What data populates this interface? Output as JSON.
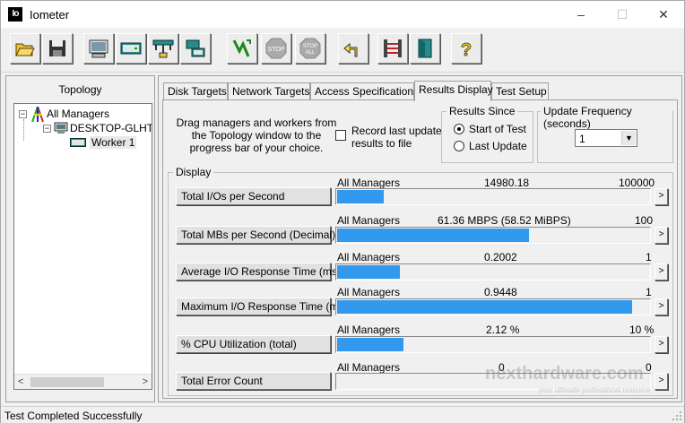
{
  "window": {
    "title": "Iometer",
    "app_icon": "Io",
    "minimize": "–",
    "maximize": "☐",
    "close": "✕"
  },
  "toolbar": {
    "buttons": [
      {
        "name": "open-config-icon"
      },
      {
        "name": "save-config-icon"
      },
      {
        "name": "show-results-icon"
      },
      {
        "name": "new-disk-worker-icon"
      },
      {
        "name": "new-network-worker-icon"
      },
      {
        "name": "duplicate-worker-icon"
      },
      {
        "name": "start-tests-icon"
      },
      {
        "name": "stop-icon"
      },
      {
        "name": "stop-all-icon"
      },
      {
        "name": "reset-workers-icon"
      },
      {
        "name": "exit-icon"
      },
      {
        "name": "about-icon"
      }
    ],
    "stop_label": "STOP",
    "stop_all_label_1": "STOP",
    "stop_all_label_2": "ALL",
    "help_label": "?"
  },
  "topology": {
    "title": "Topology",
    "all_managers": "All Managers",
    "manager": "DESKTOP-GLHTN",
    "worker": "Worker 1",
    "collapse_symbol": "−",
    "scroll_left": "<",
    "scroll_right": ">"
  },
  "tabs": [
    {
      "label": "Disk Targets"
    },
    {
      "label": "Network Targets"
    },
    {
      "label": "Access Specifications"
    },
    {
      "label": "Results Display"
    },
    {
      "label": "Test Setup"
    }
  ],
  "results": {
    "drag_text": "Drag managers and workers from the Topology window to the progress bar of your choice.",
    "record_label": "Record last update results to file",
    "record_checked": false,
    "results_since_title": "Results Since",
    "start_of_test": "Start of Test",
    "last_update": "Last Update",
    "selected_since": "Start of Test",
    "update_freq_title": "Update Frequency (seconds)",
    "update_freq_value": "1",
    "display_title": "Display",
    "metrics": [
      {
        "label": "Total I/Os per Second",
        "source": "All Managers",
        "value": "14980.18",
        "max": "100000",
        "fraction": 0.1498
      },
      {
        "label": "Total MBs per Second (Decimal)",
        "source": "All Managers",
        "value": "61.36 MBPS (58.52 MiBPS)",
        "max": "100",
        "fraction": 0.6136
      },
      {
        "label": "Average I/O Response Time (ms)",
        "source": "All Managers",
        "value": "0.2002",
        "max": "1",
        "fraction": 0.2002
      },
      {
        "label": "Maximum I/O Response Time (ms)",
        "source": "All Managers",
        "value": "0.9448",
        "max": "1",
        "fraction": 0.9448
      },
      {
        "label": "% CPU Utilization (total)",
        "source": "All Managers",
        "value": "2.12 %",
        "max": "10 %",
        "fraction": 0.212
      },
      {
        "label": "Total Error Count",
        "source": "All Managers",
        "value": "0",
        "max": "0",
        "fraction": 0
      }
    ],
    "more_symbol": ">"
  },
  "status": {
    "text": "Test Completed Successfully"
  },
  "watermark": {
    "logo": "nexthardware.com",
    "tagline": "your ultimate professional resource"
  },
  "colors": {
    "bar": "#3399ee"
  }
}
